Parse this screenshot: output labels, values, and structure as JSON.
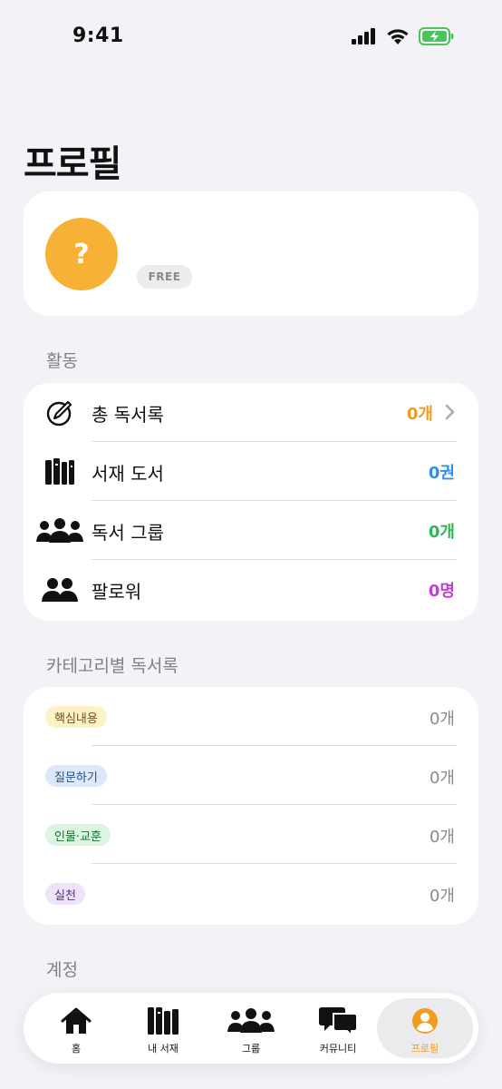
{
  "status_bar": {
    "time": "9:41"
  },
  "header": {
    "title": "프로필"
  },
  "profile": {
    "avatar_text": "?",
    "plan_badge": "FREE"
  },
  "activity": {
    "section_label": "활동",
    "rows": [
      {
        "label": "총 독서록",
        "value": "0개",
        "color": "#f29c1f",
        "icon": "pen-circle-icon",
        "has_chevron": true
      },
      {
        "label": "서재 도서",
        "value": "0권",
        "color": "#2f8ee5",
        "icon": "books-icon",
        "has_chevron": false
      },
      {
        "label": "독서 그룹",
        "value": "0개",
        "color": "#2fb657",
        "icon": "group-icon",
        "has_chevron": false
      },
      {
        "label": "팔로워",
        "value": "0명",
        "color": "#c23ed6",
        "icon": "followers-icon",
        "has_chevron": false
      }
    ]
  },
  "categories": {
    "section_label": "카테고리별 독서록",
    "rows": [
      {
        "tag": "핵심내용",
        "count": "0개",
        "bg": "#fdf1c6",
        "fg": "#7a4d10"
      },
      {
        "tag": "질문하기",
        "count": "0개",
        "bg": "#dde9fb",
        "fg": "#234b8c"
      },
      {
        "tag": "인물·교훈",
        "count": "0개",
        "bg": "#dcf5e2",
        "fg": "#1f6b33"
      },
      {
        "tag": "실천",
        "count": "0개",
        "bg": "#efe2fb",
        "fg": "#5e2d8a"
      }
    ]
  },
  "account": {
    "section_label": "계정"
  },
  "tabbar": {
    "tabs": [
      {
        "label": "홈",
        "icon": "home-icon"
      },
      {
        "label": "내 서재",
        "icon": "library-icon"
      },
      {
        "label": "그룹",
        "icon": "group-icon"
      },
      {
        "label": "커뮤니티",
        "icon": "chat-bubbles-icon"
      },
      {
        "label": "프로필",
        "icon": "profile-icon",
        "active": true
      }
    ]
  }
}
